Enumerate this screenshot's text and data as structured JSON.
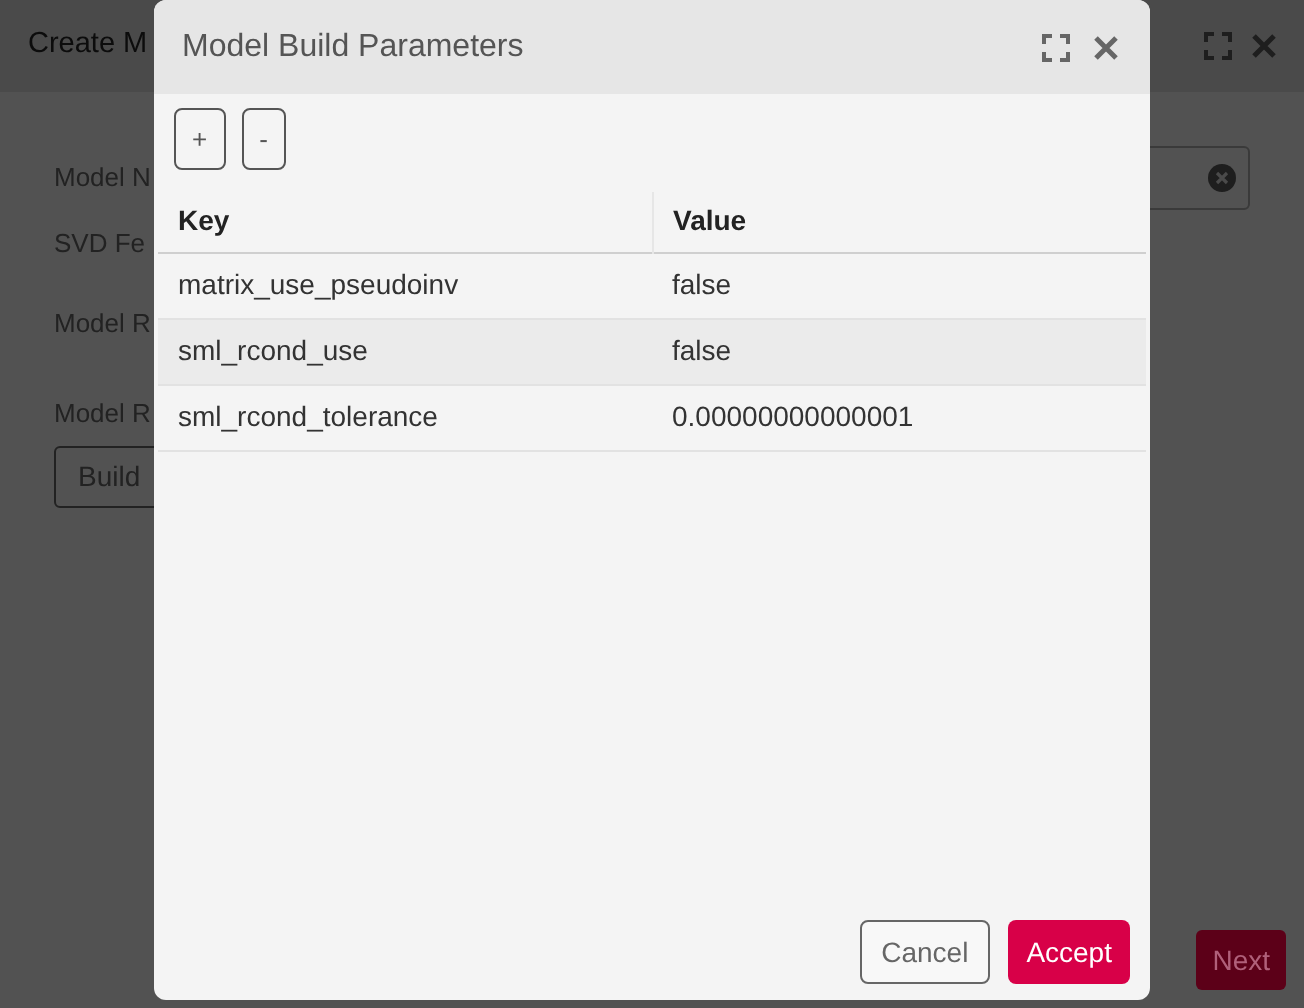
{
  "background_dialog": {
    "title": "Create M",
    "labels": [
      "Model N",
      "SVD Fe",
      "Model R",
      "Model R"
    ],
    "build_button": "Build",
    "next_button": "Next"
  },
  "modal": {
    "title": "Model Build Parameters",
    "toolbar": [
      "+",
      "-"
    ],
    "table": {
      "columns": [
        "Key",
        "Value"
      ],
      "rows": [
        [
          "matrix_use_pseudoinv",
          "false"
        ],
        [
          "sml_rcond_use",
          "false"
        ],
        [
          "sml_rcond_tolerance",
          "0.00000000000001"
        ]
      ]
    },
    "buttons": [
      {
        "label": "Cancel",
        "kind": "secondary"
      },
      {
        "label": "Accept",
        "kind": "primary"
      }
    ]
  }
}
